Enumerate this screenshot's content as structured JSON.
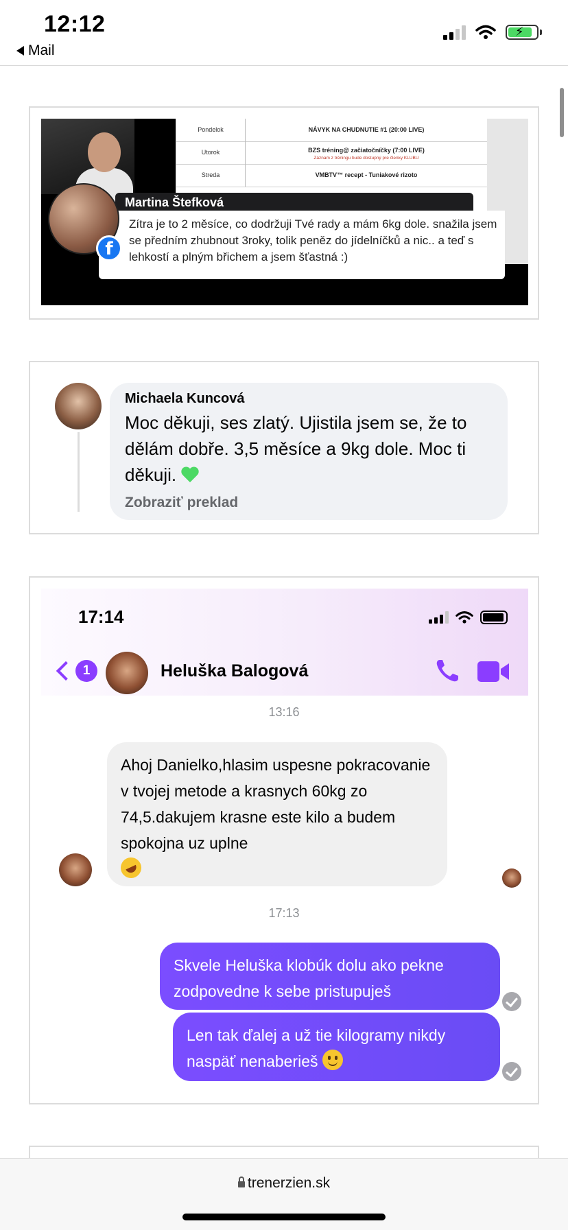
{
  "status_bar": {
    "time": "12:12",
    "back_label": "Mail"
  },
  "card1": {
    "schedule": [
      {
        "day": "Pondelok",
        "event": "NÁVYK NA CHUDNUTIE #1 (20:00 LIVE)",
        "note": ""
      },
      {
        "day": "Utorok",
        "event": "BZS tréning@ začiatočníčky (7:00 LIVE)",
        "note": "Záznam z tréningu bude dostupný pre členky KLUBU"
      },
      {
        "day": "Streda",
        "event": "VMBTV™ recept - Tuniakové rizoto",
        "note": ""
      }
    ],
    "commenter_name": "Martina Štefková",
    "comment_text": "Zítra je to 2 měsíce, co dodržuji Tvé rady a mám 6kg dole. snažila jsem se předním zhubnout 3roky, tolik peněz do jídelníčků a nic.. a teď s lehkostí a plným břichem a jsem šťastná :)"
  },
  "card2": {
    "name": "Michaela Kuncová",
    "message": "Moc děkuji, ses zlatý. Ujistila jsem se, že to dělám dobře. 3,5 měsíce a 9kg dole.  Moc ti děkuji.",
    "translate_label": "Zobraziť preklad"
  },
  "card3": {
    "time": "17:14",
    "unread_count": "1",
    "contact_name": "Heluška Balogová",
    "timestamp1": "13:16",
    "incoming_message": "Ahoj Danielko,hlasim uspesne pokracovanie v tvojej metode a krasnych 60kg zo 74,5.dakujem krasne este kilo a budem spokojna uz uplne",
    "timestamp2": "17:13",
    "outgoing_message1": "Skvele Heluška klobúk dolu ako pekne zodpovedne k sebe pristupuješ",
    "outgoing_message2": "Len tak ďalej a už tie kilogramy nikdy naspäť nenaberieš",
    "accent_color": "#8b3dff"
  },
  "browser": {
    "url": "trenerzien.sk"
  }
}
